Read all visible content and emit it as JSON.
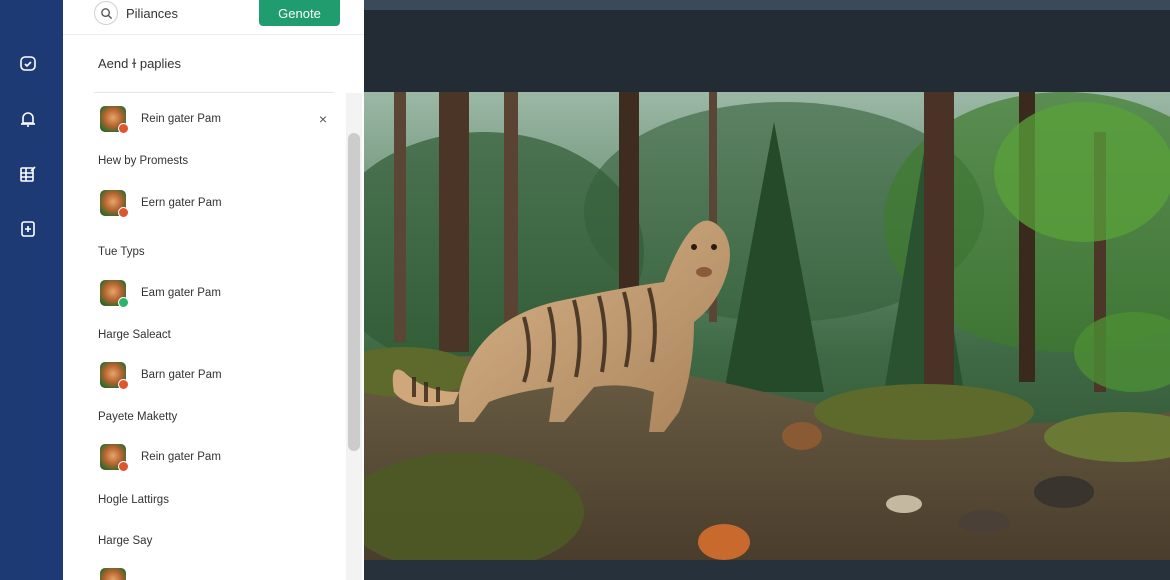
{
  "search": {
    "label": "Piliances"
  },
  "generate_button": {
    "label": "Genote"
  },
  "panel": {
    "section_title": "Aend ɫ paplies",
    "close_symbol": "×",
    "items": [
      {
        "label": "Rein gater Pam",
        "badge_color": "#e0542f"
      },
      {
        "label": "Eern gater Pam",
        "badge_color": "#e0542f"
      },
      {
        "label": "Eam gater Pam",
        "badge_color": "#2bb56a"
      },
      {
        "label": "Barn gater Pam",
        "badge_color": "#e0542f"
      },
      {
        "label": "Rein gater Pam",
        "badge_color": "#e0542f"
      }
    ],
    "groups": [
      "Hew by Promests",
      "Tue Typs",
      "Harge Saleact",
      "Payete Maketty",
      "Hogle Lattirgs",
      "Harge Say"
    ]
  },
  "colors": {
    "rail": "#1d3a75",
    "accent": "#1f9d6e"
  },
  "image": {
    "subject": "tiger-like animal in pine forest"
  }
}
